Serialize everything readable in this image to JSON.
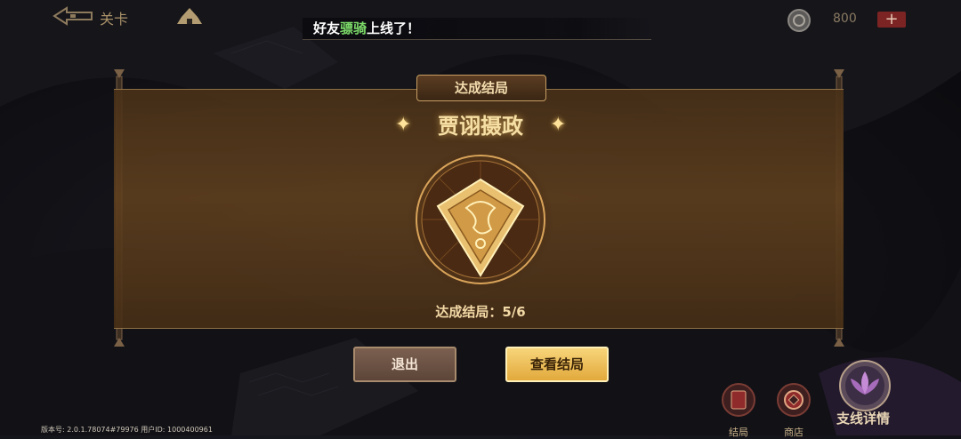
{
  "topbar": {
    "stage_label": "关卡",
    "notice_prefix": "好友",
    "notice_highlight": "骠骑",
    "notice_suffix": "上线了！",
    "coin_value": "800",
    "add_label": "+"
  },
  "panel": {
    "header": "达成结局",
    "ending_name": "贾诩摄政",
    "progress_text": "达成结局：5/6"
  },
  "buttons": {
    "exit": "退出",
    "view_endings": "查看结局"
  },
  "side": {
    "endings_label": "结局",
    "shop_label": "商店",
    "branch_label": "支线详情"
  },
  "footer": {
    "version_text": "版本号: 2.0.1.78074#79976 用户ID: 1000400961"
  },
  "colors": {
    "accent_gold": "#f6dfa4",
    "notice_highlight": "#7ddc6a",
    "add_button": "#7c2323"
  }
}
